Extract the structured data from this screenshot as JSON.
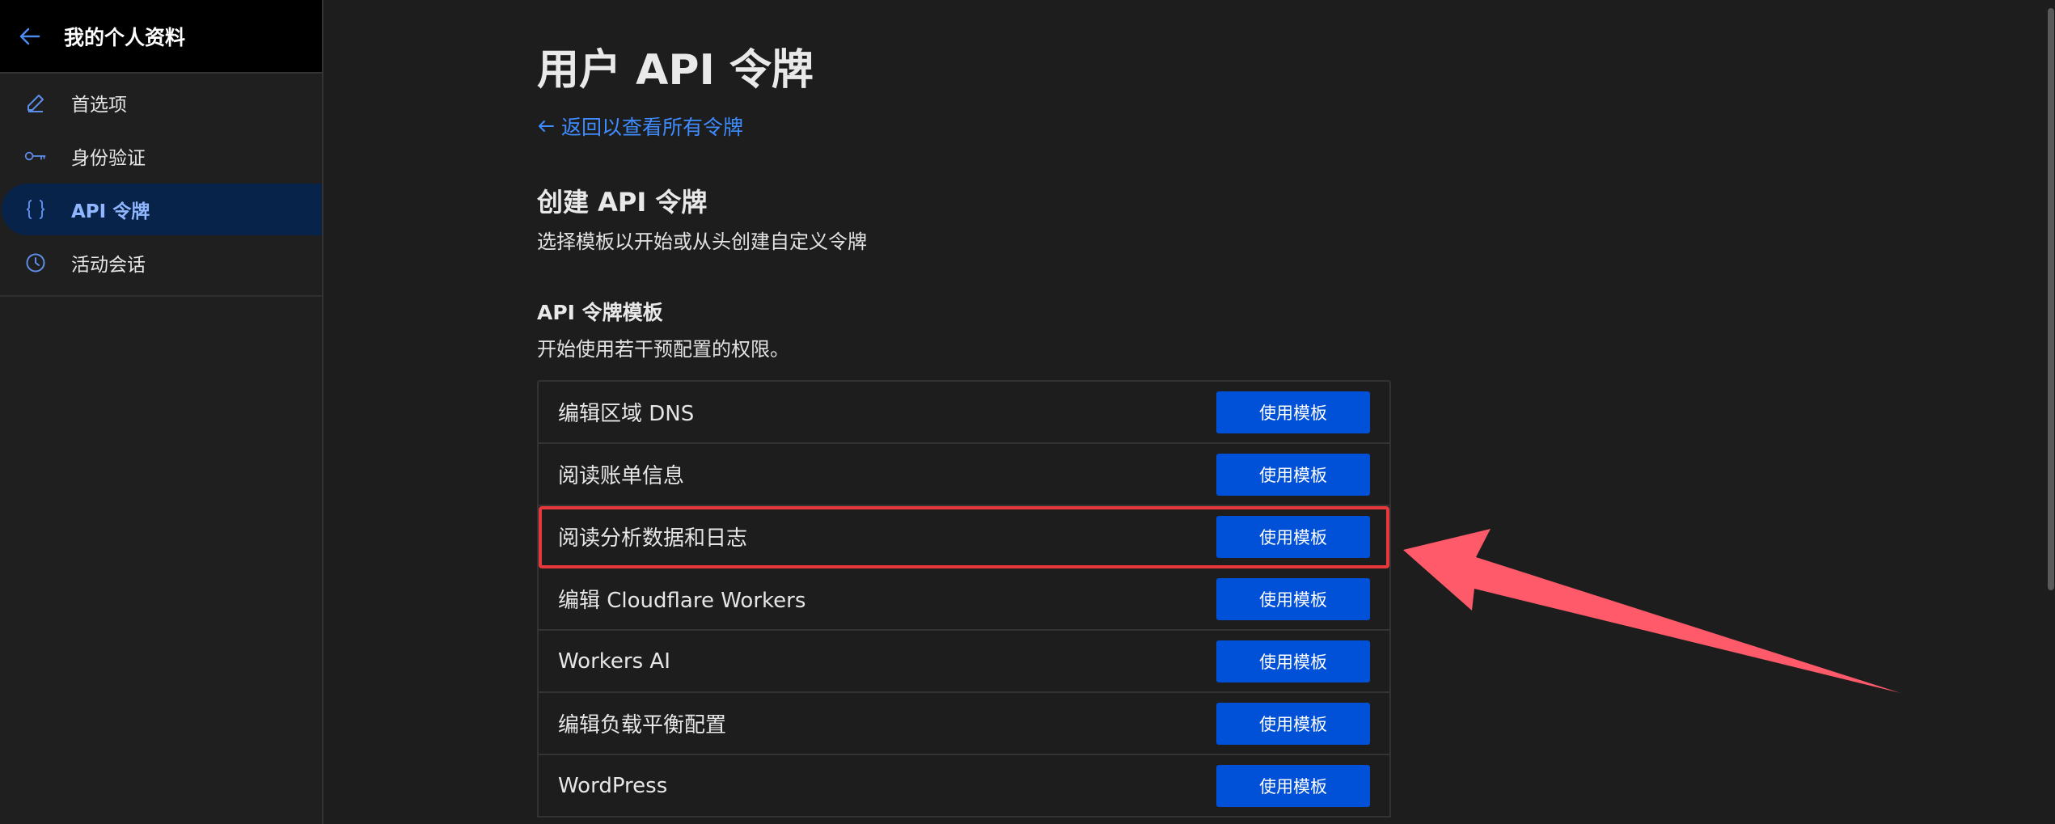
{
  "sidebar": {
    "title": "我的个人资料",
    "items": [
      {
        "label": "首选项",
        "icon": "edit-icon"
      },
      {
        "label": "身份验证",
        "icon": "key-icon"
      },
      {
        "label": "API 令牌",
        "icon": "braces-icon"
      },
      {
        "label": "活动会话",
        "icon": "clock-icon"
      }
    ]
  },
  "main": {
    "title": "用户 API 令牌",
    "back_link": "返回以查看所有令牌",
    "section_title": "创建 API 令牌",
    "section_desc": "选择模板以开始或从头创建自定义令牌",
    "templates_title": "API 令牌模板",
    "templates_desc": "开始使用若干预配置的权限。",
    "templates": [
      {
        "name": "编辑区域 DNS",
        "button": "使用模板"
      },
      {
        "name": "阅读账单信息",
        "button": "使用模板"
      },
      {
        "name": "阅读分析数据和日志",
        "button": "使用模板"
      },
      {
        "name": "编辑 Cloudflare Workers",
        "button": "使用模板"
      },
      {
        "name": "Workers AI",
        "button": "使用模板"
      },
      {
        "name": "编辑负载平衡配置",
        "button": "使用模板"
      },
      {
        "name": "WordPress",
        "button": "使用模板"
      }
    ]
  },
  "colors": {
    "accent": "#0051d8",
    "link": "#3f8cff",
    "highlight": "#e5373c",
    "arrow": "#ff5a6a"
  }
}
